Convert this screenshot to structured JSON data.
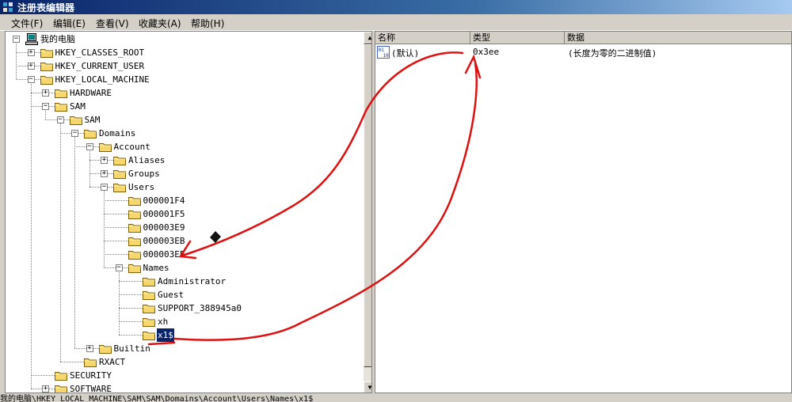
{
  "window": {
    "title": "注册表编辑器"
  },
  "menu": [
    "文件(F)",
    "编辑(E)",
    "查看(V)",
    "收藏夹(A)",
    "帮助(H)"
  ],
  "tree": [
    {
      "label": "我的电脑",
      "level": 0,
      "expander": "minus",
      "icon": "computer"
    },
    {
      "label": "HKEY_CLASSES_ROOT",
      "level": 1,
      "expander": "plus"
    },
    {
      "label": "HKEY_CURRENT_USER",
      "level": 1,
      "expander": "plus"
    },
    {
      "label": "HKEY_LOCAL_MACHINE",
      "level": 1,
      "expander": "minus"
    },
    {
      "label": "HARDWARE",
      "level": 2,
      "expander": "plus"
    },
    {
      "label": "SAM",
      "level": 2,
      "expander": "minus"
    },
    {
      "label": "SAM",
      "level": 3,
      "expander": "minus"
    },
    {
      "label": "Domains",
      "level": 4,
      "expander": "minus"
    },
    {
      "label": "Account",
      "level": 5,
      "expander": "minus"
    },
    {
      "label": "Aliases",
      "level": 6,
      "expander": "plus"
    },
    {
      "label": "Groups",
      "level": 6,
      "expander": "plus"
    },
    {
      "label": "Users",
      "level": 6,
      "expander": "minus"
    },
    {
      "label": "000001F4",
      "level": 7,
      "expander": "none"
    },
    {
      "label": "000001F5",
      "level": 7,
      "expander": "none"
    },
    {
      "label": "000003E9",
      "level": 7,
      "expander": "none"
    },
    {
      "label": "000003EB",
      "level": 7,
      "expander": "none"
    },
    {
      "label": "000003EE",
      "level": 7,
      "expander": "none"
    },
    {
      "label": "Names",
      "level": 7,
      "expander": "minus"
    },
    {
      "label": "Administrator",
      "level": 8,
      "expander": "none"
    },
    {
      "label": "Guest",
      "level": 8,
      "expander": "none"
    },
    {
      "label": "SUPPORT_388945a0",
      "level": 8,
      "expander": "none"
    },
    {
      "label": "xh",
      "level": 8,
      "expander": "none"
    },
    {
      "label": "x1$",
      "level": 8,
      "expander": "none",
      "selected": true
    },
    {
      "label": "Builtin",
      "level": 5,
      "expander": "plus"
    },
    {
      "label": "RXACT",
      "level": 4,
      "expander": "none"
    },
    {
      "label": "SECURITY",
      "level": 2,
      "expander": "none"
    },
    {
      "label": "SOFTWARE",
      "level": 2,
      "expander": "plus"
    }
  ],
  "list": {
    "headers": [
      "名称",
      "类型",
      "数据"
    ],
    "rows": [
      {
        "name": "(默认)",
        "type": "0x3ee",
        "data": "(长度为零的二进制值)"
      }
    ]
  },
  "statusbar": {
    "path": "我的电脑\\HKEY_LOCAL_MACHINE\\SAM\\SAM\\Domains\\Account\\Users\\Names\\x1$"
  },
  "colors": {
    "selection": "#0a246a",
    "annotation": "#e01010",
    "folder": "#f5d76e"
  }
}
